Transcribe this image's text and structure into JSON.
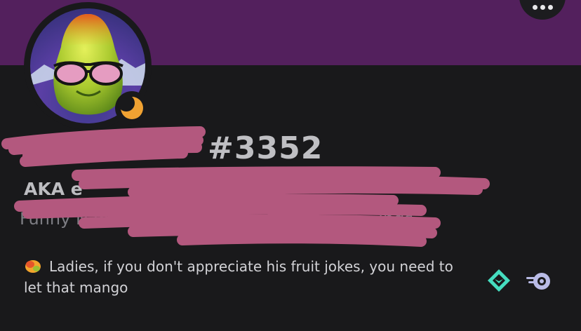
{
  "header": {
    "banner_color": "#53205d",
    "more_button_icon": "more-options-icon"
  },
  "profile": {
    "avatar_icon": "pear-with-sunglasses-avatar",
    "status": "idle",
    "status_icon": "moon-icon",
    "status_color": "#f0a232",
    "discriminator": "#3352"
  },
  "bio": {
    "line1_visible": "AKA e",
    "line2_visible": "Funny Nam",
    "line2_tail": "ings"
  },
  "custom_status": {
    "emoji_icon": "mango-emoji-icon",
    "text": "Ladies, if you don't appreciate his fruit jokes, you need to let that mango"
  },
  "badges": [
    {
      "name": "hypesquad-balance-badge",
      "color": "#45ddc0"
    },
    {
      "name": "nitro-boost-badge",
      "color": "#b9bbe6"
    }
  ],
  "redaction_color": "#b3587e"
}
